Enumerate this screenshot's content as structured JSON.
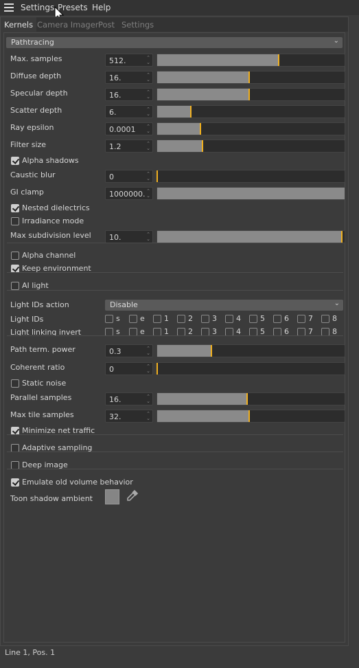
{
  "menubar": {
    "items": [
      "Settings",
      "Presets",
      "Help"
    ]
  },
  "tabs": [
    {
      "label": "Kernels",
      "active": true
    },
    {
      "label": "Camera Imager"
    },
    {
      "label": "Post"
    },
    {
      "label": "Settings"
    }
  ],
  "kernel_type": "Pathtracing",
  "rows": [
    {
      "type": "slider",
      "label": "Max. samples",
      "value": "512.",
      "fraction": 0.65
    },
    {
      "type": "slider",
      "label": "Diffuse depth",
      "value": "16.",
      "fraction": 0.49
    },
    {
      "type": "slider",
      "label": "Specular depth",
      "value": "16.",
      "fraction": 0.49
    },
    {
      "type": "slider",
      "label": "Scatter depth",
      "value": "6.",
      "fraction": 0.18
    },
    {
      "type": "slider",
      "label": "Ray epsilon",
      "value": "0.0001",
      "fraction": 0.23
    },
    {
      "type": "slider",
      "label": "Filter size",
      "value": "1.2",
      "fraction": 0.24
    },
    {
      "type": "check",
      "label": "Alpha shadows",
      "checked": true
    },
    {
      "type": "slider",
      "label": "Caustic blur",
      "value": "0",
      "fraction": 0
    },
    {
      "type": "slider",
      "label": "GI clamp",
      "value": "1000000.",
      "fraction": 1,
      "nomark": true
    },
    {
      "type": "check",
      "label": "Nested dielectrics",
      "checked": true
    },
    {
      "type": "check",
      "label": "Irradiance mode",
      "checked": false
    },
    {
      "type": "slider",
      "label": "Max subdivision level",
      "value": "10.",
      "fraction": 0.985
    },
    {
      "type": "sep"
    },
    {
      "type": "check",
      "label": "Alpha channel",
      "checked": false
    },
    {
      "type": "check",
      "label": "Keep environment",
      "checked": true
    },
    {
      "type": "sep"
    },
    {
      "type": "check",
      "label": "AI light",
      "checked": false
    },
    {
      "type": "sep"
    },
    {
      "type": "dropdown",
      "label": "Light IDs action",
      "value": "Disable"
    },
    {
      "type": "ids",
      "label": "Light IDs",
      "options": [
        "s",
        "e",
        "1",
        "2",
        "3",
        "4",
        "5",
        "6",
        "7",
        "8"
      ]
    },
    {
      "type": "ids",
      "label": "Light linking invert",
      "options": [
        "s",
        "e",
        "1",
        "2",
        "3",
        "4",
        "5",
        "6",
        "7",
        "8"
      ]
    },
    {
      "type": "sep"
    },
    {
      "type": "slider",
      "label": "Path term. power",
      "value": "0.3",
      "fraction": 0.29
    },
    {
      "type": "slider",
      "label": "Coherent ratio",
      "value": "0",
      "fraction": 0
    },
    {
      "type": "check",
      "label": "Static noise",
      "checked": false
    },
    {
      "type": "slider",
      "label": "Parallel samples",
      "value": "16.",
      "fraction": 0.48
    },
    {
      "type": "slider",
      "label": "Max tile samples",
      "value": "32.",
      "fraction": 0.49
    },
    {
      "type": "check",
      "label": "Minimize net traffic",
      "checked": true
    },
    {
      "type": "sep"
    },
    {
      "type": "check",
      "label": "Adaptive sampling",
      "checked": false
    },
    {
      "type": "sep"
    },
    {
      "type": "check",
      "label": "Deep image",
      "checked": false
    },
    {
      "type": "sep"
    },
    {
      "type": "check",
      "label": "Emulate old volume behavior",
      "checked": true
    },
    {
      "type": "color",
      "label": "Toon shadow ambient",
      "color": "#858585"
    }
  ],
  "colors": {
    "accent": "#f0b020",
    "background": "#3b3b3b"
  },
  "status": "Line 1, Pos. 1"
}
